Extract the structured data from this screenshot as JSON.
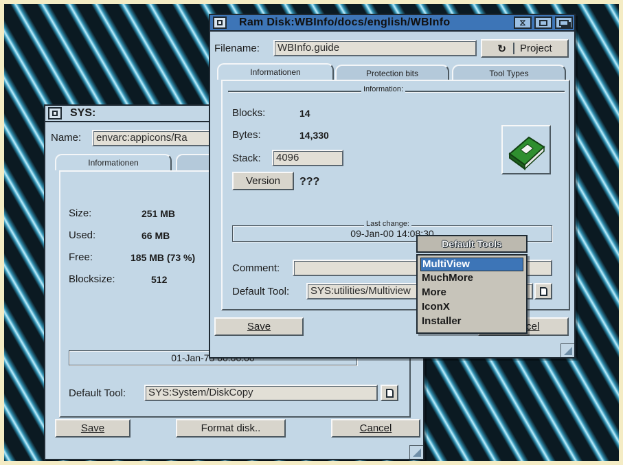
{
  "sys_window": {
    "title": "SYS:",
    "name_label": "Name:",
    "name_value": "envarc:appicons/Ra",
    "tab_info": "Informationen",
    "size_label": "Size:",
    "size_value": "251 MB",
    "used_label": "Used:",
    "used_value": "66 MB",
    "free_label": "Free:",
    "free_value": "185 MB (73 %)",
    "blocksize_label": "Blocksize:",
    "blocksize_value": "512",
    "date_value": "01-Jan-78 00:00:00",
    "default_tool_label": "Default Tool:",
    "default_tool_value": "SYS:System/DiskCopy",
    "save_label": "Save",
    "format_label": "Format disk..",
    "cancel_label": "Cancel"
  },
  "ram_window": {
    "title": "Ram Disk:WBInfo/docs/english/WBInfo",
    "filename_label": "Filename:",
    "filename_value": "WBInfo.guide",
    "type_label": "Project",
    "tabs": [
      "Informationen",
      "Protection bits",
      "Tool Types"
    ],
    "info_group_title": "Information:",
    "blocks_label": "Blocks:",
    "blocks_value": "14",
    "bytes_label": "Bytes:",
    "bytes_value": "14,330",
    "stack_label": "Stack:",
    "stack_value": "4096",
    "version_label": "Version",
    "version_value": "???",
    "last_change_title": "Last change:",
    "last_change_value": "09-Jan-00 14:08:30",
    "comment_label": "Comment:",
    "comment_value": "",
    "default_tool_label": "Default Tool:",
    "default_tool_value": "SYS:utilities/Multiview",
    "save_label": "Save",
    "cancel_label": "Cancel"
  },
  "popup_menu": {
    "title": "Default Tools",
    "items": [
      "MultiView",
      "MuchMore",
      "More",
      "IconX",
      "Installer"
    ],
    "selected": "MultiView"
  },
  "icons": {
    "close": "close-icon",
    "cycle": "cycle-icon",
    "file_requester": "file-requester-icon",
    "book": "book-icon",
    "depth": "depth-icon",
    "zoom": "zoom-icon",
    "iconify": "iconify-icon"
  },
  "colors": {
    "window_bg": "#c3d7e6",
    "active_title": "#3d75b7",
    "menu_highlight": "#3d75b7",
    "book_green": "#2f8f2f"
  }
}
